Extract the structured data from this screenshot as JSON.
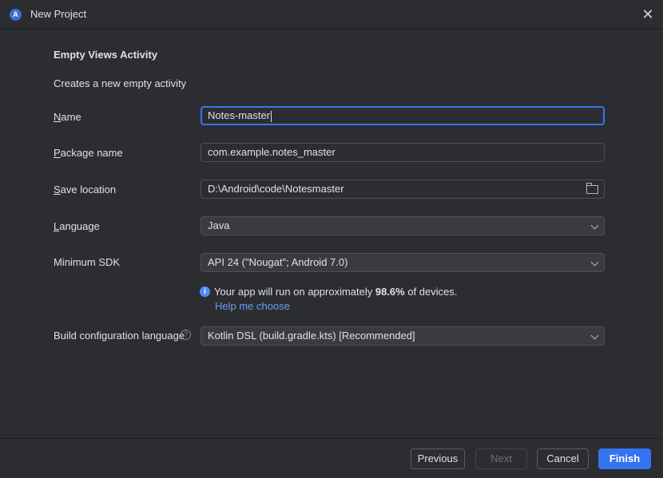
{
  "window": {
    "title": "New Project",
    "close_glyph": "✕",
    "app_icon_letter": "A"
  },
  "header": {
    "template_name": "Empty Views Activity",
    "description": "Creates a new empty activity"
  },
  "form": {
    "name": {
      "label_first": "N",
      "label_rest": "ame",
      "value": "Notes-master"
    },
    "package": {
      "label_first": "P",
      "label_rest": "ackage name",
      "value": "com.example.notes_master"
    },
    "save_location": {
      "label_first": "S",
      "label_rest": "ave location",
      "value": "D:\\Android\\code\\Notesmaster",
      "icon": "folder-icon"
    },
    "language": {
      "label_first": "L",
      "label_rest": "anguage",
      "value": "Java"
    },
    "min_sdk": {
      "label": "Minimum SDK",
      "value": "API 24 (\"Nougat\"; Android 7.0)"
    },
    "sdk_info": {
      "prefix": "Your app will run on approximately ",
      "percent": "98.6%",
      "suffix": " of devices.",
      "help_link": "Help me choose",
      "icon_glyph": "i"
    },
    "build_config": {
      "label": "Build configuration language",
      "value": "Kotlin DSL (build.gradle.kts) [Recommended]",
      "help_glyph": "?"
    }
  },
  "footer": {
    "previous": "Previous",
    "next": "Next",
    "cancel": "Cancel",
    "finish": "Finish"
  },
  "colors": {
    "accent": "#3574f0",
    "link": "#6c9bf5",
    "background": "#2b2d30"
  }
}
